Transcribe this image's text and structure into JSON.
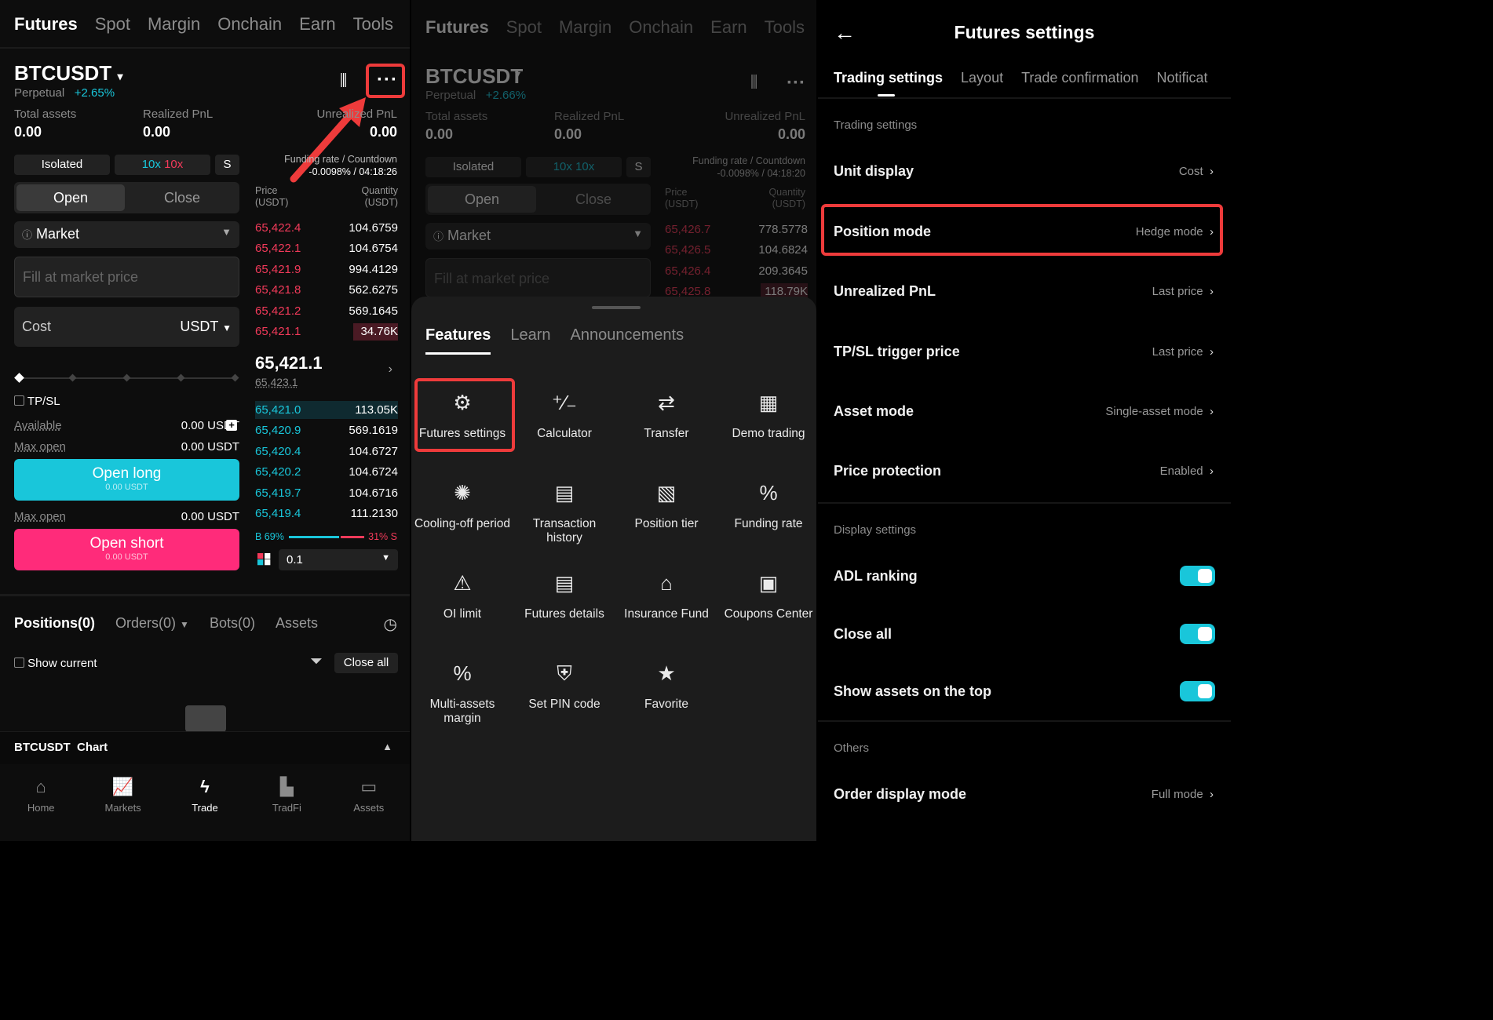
{
  "trade_screen": {
    "tabs": [
      "Futures",
      "Spot",
      "Margin",
      "Onchain",
      "Earn",
      "Tools"
    ],
    "pair": "BTCUSDT",
    "perpetual": "Perpetual",
    "change": "+2.65%",
    "total_assets_label": "Total assets",
    "total_assets": "0.00",
    "realized_label": "Realized PnL",
    "realized": "0.00",
    "unrealized_label": "Unrealized PnL",
    "unrealized": "0.00",
    "isolated": "Isolated",
    "lev_a": "10x",
    "lev_b": "10x",
    "s_label": "S",
    "funding_label": "Funding rate / Countdown",
    "funding_value": "-0.0098% / 04:18:26",
    "open": "Open",
    "close": "Close",
    "order_type": "Market",
    "price_placeholder": "Fill at market price",
    "cost": "Cost",
    "currency": "USDT",
    "tpsl": "TP/SL",
    "available_label": "Available",
    "available": "0.00 USDT",
    "maxopen_label": "Max open",
    "maxopen": "0.00 USDT",
    "open_long": "Open long",
    "open_long_sub": "0.00 USDT",
    "maxopen2": "0.00 USDT",
    "open_short": "Open short",
    "open_short_sub": "0.00 USDT",
    "price_head": "Price\n(USDT)",
    "qty_head": "Quantity\n(USDT)",
    "asks": [
      [
        "65,422.4",
        "104.6759"
      ],
      [
        "65,422.1",
        "104.6754"
      ],
      [
        "65,421.9",
        "994.4129"
      ],
      [
        "65,421.8",
        "562.6275"
      ],
      [
        "65,421.2",
        "569.1645"
      ],
      [
        "65,421.1",
        "34.76K"
      ]
    ],
    "last_price": "65,421.1",
    "mark_price": "65,423.1",
    "bids": [
      [
        "65,421.0",
        "113.05K"
      ],
      [
        "65,420.9",
        "569.1619"
      ],
      [
        "65,420.4",
        "104.6727"
      ],
      [
        "65,420.2",
        "104.6724"
      ],
      [
        "65,419.7",
        "104.6716"
      ],
      [
        "65,419.4",
        "111.2130"
      ]
    ],
    "b_pct": "B 69%",
    "s_pct": "31% S",
    "precision": "0.1",
    "positions": "Positions(0)",
    "orders": "Orders(0)",
    "bots": "Bots(0)",
    "assets": "Assets",
    "show_current": "Show current",
    "close_all": "Close all",
    "chart_label": "BTCUSDT  Chart",
    "nav": [
      "Home",
      "Markets",
      "Trade",
      "TradFi",
      "Assets"
    ]
  },
  "menu_screen": {
    "tabs": [
      "Futures",
      "Spot",
      "Margin",
      "Onchain",
      "Earn",
      "Tools"
    ],
    "pair": "BTCUSDT",
    "perpetual": "Perpetual",
    "change": "+2.66%",
    "total_assets_label": "Total assets",
    "total_assets": "0.00",
    "realized_label": "Realized PnL",
    "realized": "0.00",
    "unrealized_label": "Unrealized PnL",
    "unrealized": "0.00",
    "isolated": "Isolated",
    "lev": "10x 10x",
    "s_label": "S",
    "funding_label": "Funding rate / Countdown",
    "funding_value": "-0.0098% / 04:18:20",
    "open": "Open",
    "close": "Close",
    "order_type": "Market",
    "price_placeholder": "Fill at market price",
    "price_head": "Price\n(USDT)",
    "qty_head": "Quantity\n(USDT)",
    "asks": [
      [
        "65,426.7",
        "778.5778"
      ],
      [
        "65,426.5",
        "104.6824"
      ],
      [
        "65,426.4",
        "209.3645"
      ],
      [
        "65,425.8",
        "118.79K"
      ]
    ],
    "sheet_tabs": [
      "Features",
      "Learn",
      "Announcements"
    ],
    "features": [
      {
        "label": "Futures settings",
        "icon": "gear-icon",
        "glyph": "⚙"
      },
      {
        "label": "Calculator",
        "icon": "calculator-icon",
        "glyph": "⁺⁄₋"
      },
      {
        "label": "Transfer",
        "icon": "transfer-icon",
        "glyph": "⇄"
      },
      {
        "label": "Demo trading",
        "icon": "demo-icon",
        "glyph": "▦"
      },
      {
        "label": "Cooling-off period",
        "icon": "cooling-icon",
        "glyph": "✺"
      },
      {
        "label": "Transaction\nhistory",
        "icon": "history-icon",
        "glyph": "▤"
      },
      {
        "label": "Position tier",
        "icon": "tier-icon",
        "glyph": "▧"
      },
      {
        "label": "Funding rate",
        "icon": "percent-icon",
        "glyph": "%"
      },
      {
        "label": "OI limit",
        "icon": "warning-icon",
        "glyph": "⚠"
      },
      {
        "label": "Futures details",
        "icon": "details-icon",
        "glyph": "▤"
      },
      {
        "label": "Insurance Fund",
        "icon": "bank-icon",
        "glyph": "⌂"
      },
      {
        "label": "Coupons Center",
        "icon": "coupon-icon",
        "glyph": "▣"
      },
      {
        "label": "Multi-assets\nmargin",
        "icon": "multi-asset-icon",
        "glyph": "%"
      },
      {
        "label": "Set PIN code",
        "icon": "shield-icon",
        "glyph": "⛨"
      },
      {
        "label": "Favorite",
        "icon": "star-icon",
        "glyph": "★"
      }
    ]
  },
  "settings_screen": {
    "title": "Futures settings",
    "tabs": [
      "Trading settings",
      "Layout",
      "Trade confirmation",
      "Notificat"
    ],
    "trading_section": "Trading settings",
    "rows": [
      {
        "label": "Unit display",
        "value": "Cost"
      },
      {
        "label": "Position mode",
        "value": "Hedge mode"
      },
      {
        "label": "Unrealized PnL",
        "value": "Last price"
      },
      {
        "label": "TP/SL trigger price",
        "value": "Last price"
      },
      {
        "label": "Asset mode",
        "value": "Single-asset mode"
      },
      {
        "label": "Price protection",
        "value": "Enabled"
      }
    ],
    "display_section": "Display settings",
    "toggles": [
      "ADL ranking",
      "Close all",
      "Show assets on the top"
    ],
    "others_section": "Others",
    "order_display": {
      "label": "Order display mode",
      "value": "Full mode"
    }
  },
  "colors": {
    "accent": "#19c6da",
    "sell": "#f23a5a",
    "short": "#ff2b7a",
    "highlight": "#ee3b3b"
  }
}
